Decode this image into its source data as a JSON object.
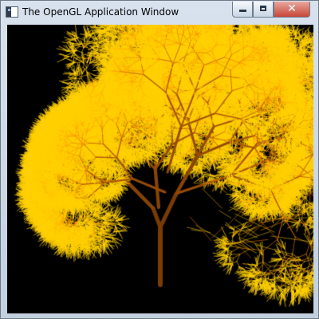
{
  "window": {
    "title": "The OpenGL Application Window"
  },
  "controls": {
    "minimize": "",
    "maximize": "",
    "close": "✕"
  },
  "scene": {
    "background": "#000000",
    "trunk_color": "#7a3b05",
    "branch_color": "#b95d0b",
    "twig_color": "#ffd000",
    "accent_color": "#ff8a00"
  }
}
